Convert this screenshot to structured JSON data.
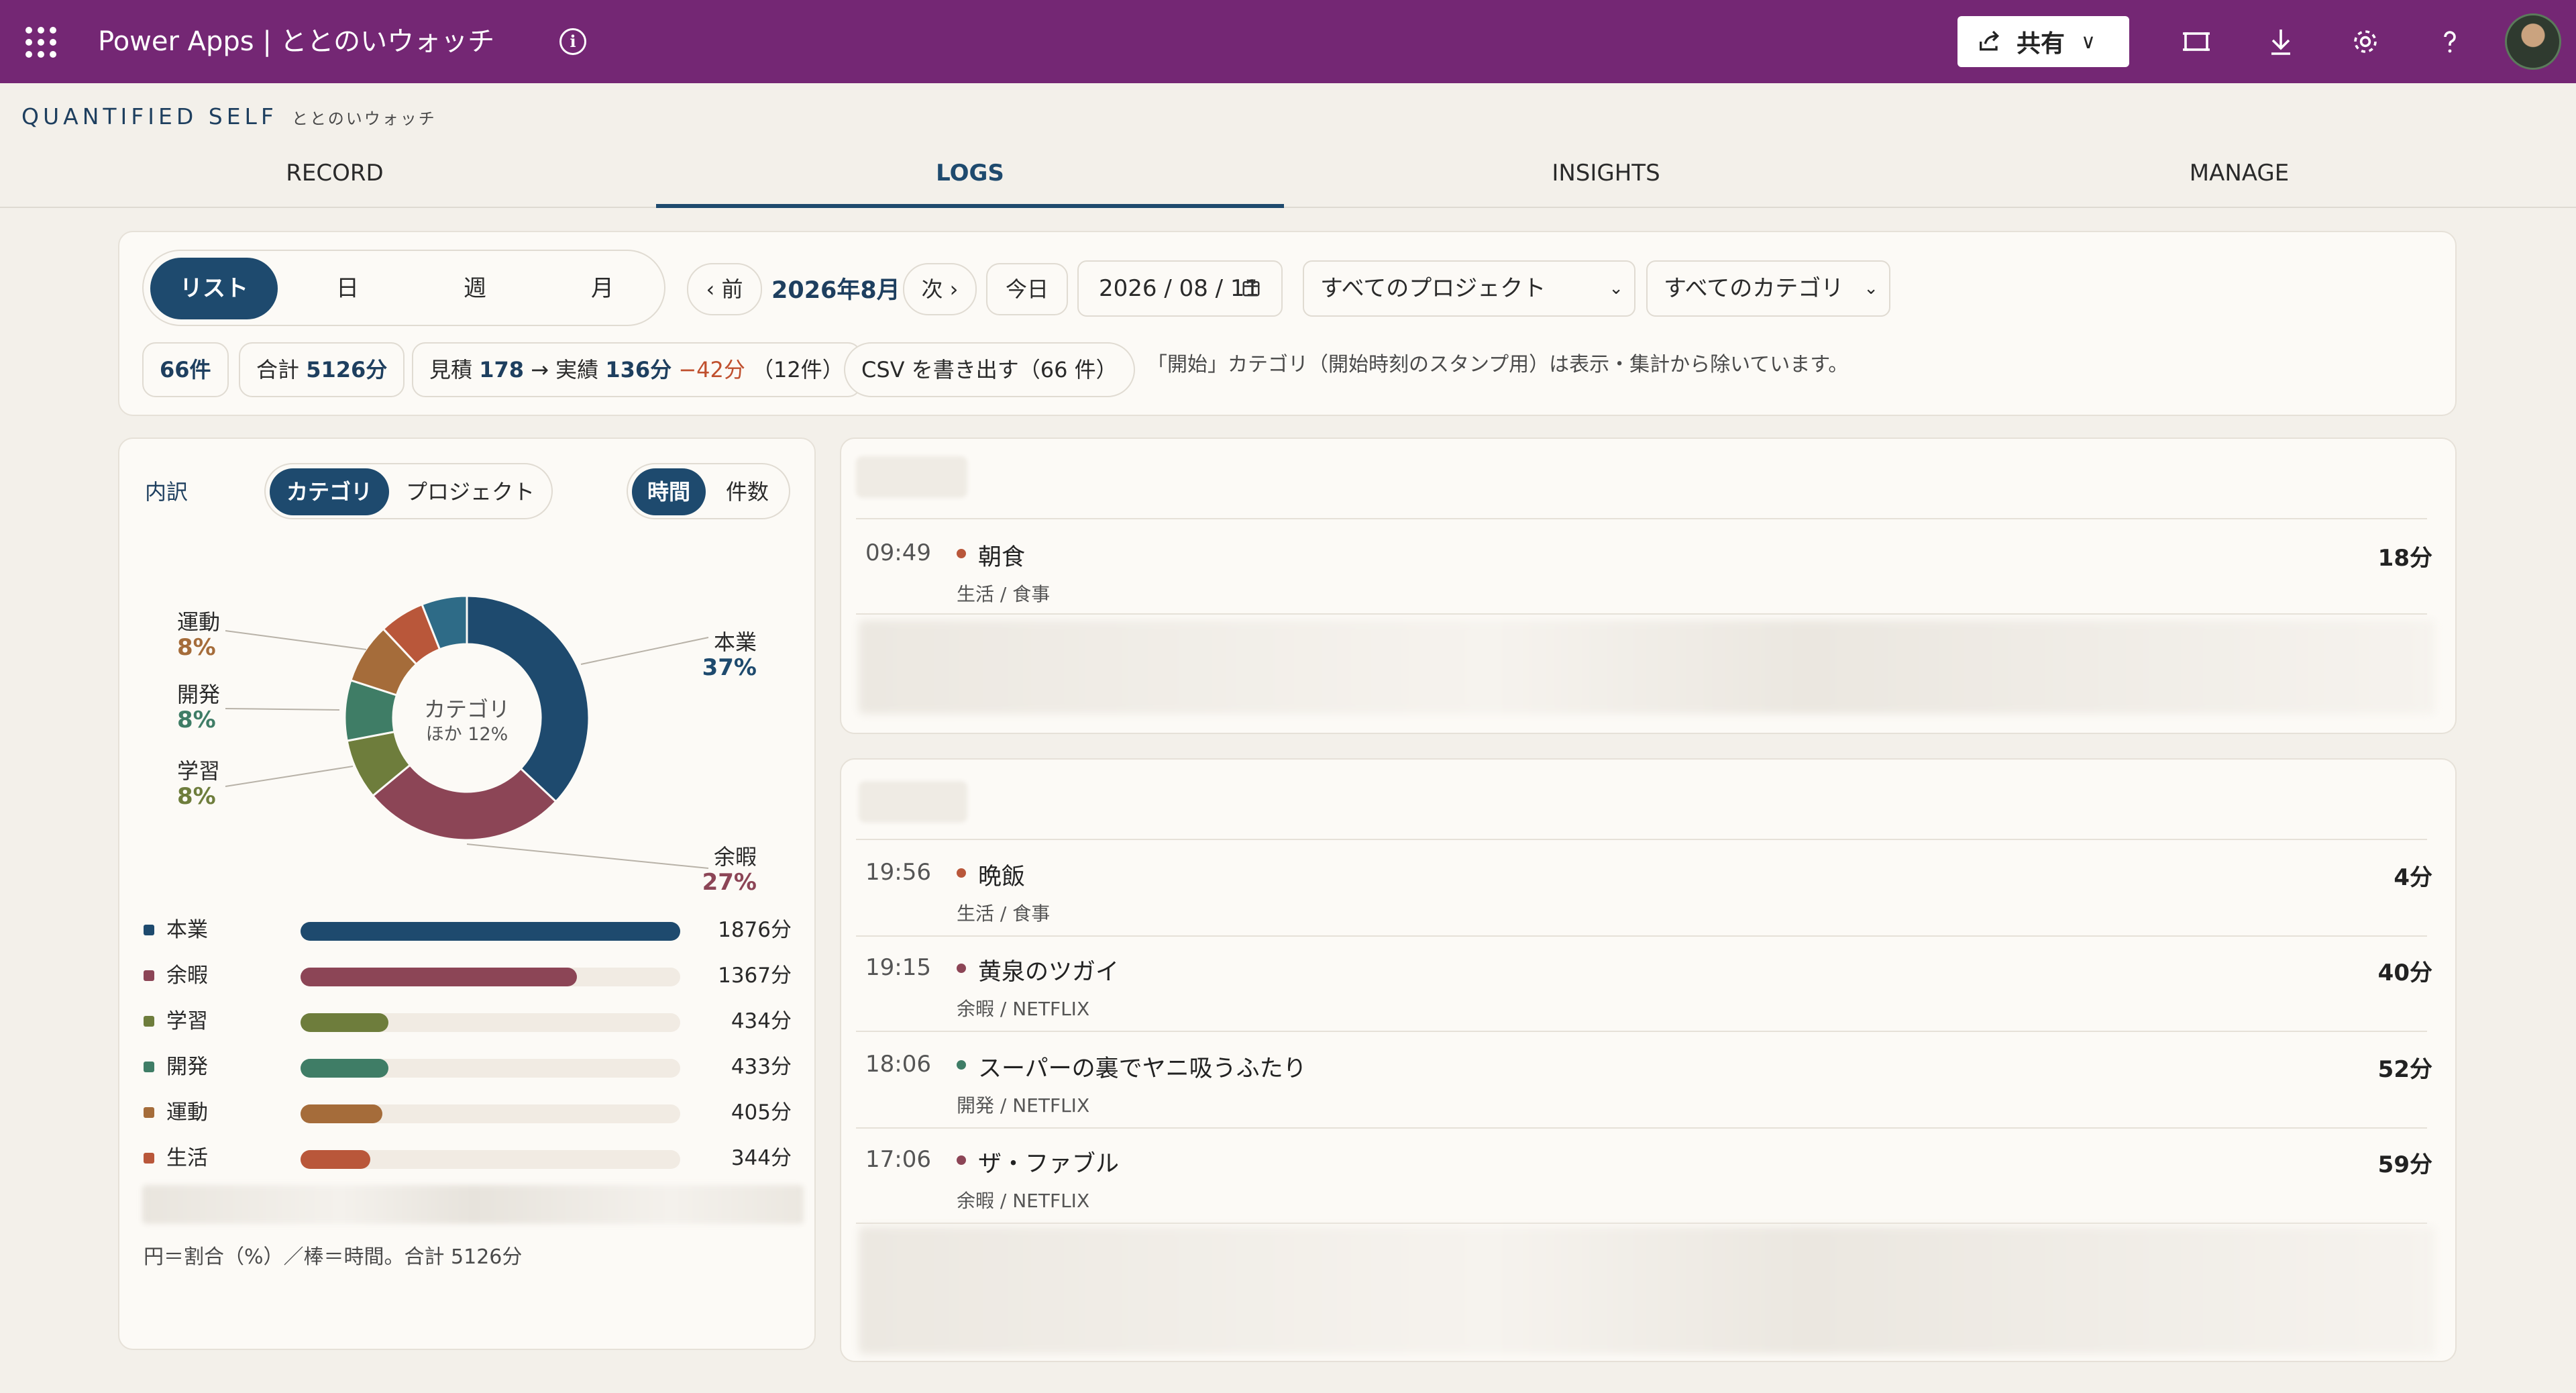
{
  "topbar": {
    "app_title": "Power Apps | ととのいウォッチ",
    "share_label": "共有",
    "icons": [
      "waffle-icon",
      "info-icon",
      "share-icon",
      "fit-screen-icon",
      "download-icon",
      "settings-icon",
      "help-icon",
      "avatar"
    ]
  },
  "header": {
    "brand": "QUANTIFIED SELF",
    "brand_sub": "ととのいウォッチ"
  },
  "tabs": [
    "RECORD",
    "LOGS",
    "INSIGHTS",
    "MANAGE"
  ],
  "active_tab": "LOGS",
  "filters": {
    "view_modes": [
      "リスト",
      "日",
      "週",
      "月"
    ],
    "active_view": "リスト",
    "prev_label": "‹ 前",
    "month_label": "2026年8月",
    "next_label": "次 ›",
    "today_label": "今日",
    "date_value": "2026 / 08 / 11",
    "project_select": "すべてのプロジェクト",
    "category_select": "すべてのカテゴリ",
    "count_value": "66件",
    "total_prefix": "合計",
    "total_value": "5126分",
    "estimate_prefix": "見積",
    "estimate_value": "178",
    "actual_prefix": "→ 実績",
    "actual_value": "136分",
    "diff_value": "−42分",
    "diff_count": "（12件）",
    "csv_label": "CSV を書き出す（66 件）",
    "note": "「開始」カテゴリ（開始時刻のスタンプ用）は表示・集計から除いています。"
  },
  "breakdown": {
    "title": "内訳",
    "group_modes": [
      "カテゴリ",
      "プロジェクト"
    ],
    "active_group": "カテゴリ",
    "metric_modes": [
      "時間",
      "件数"
    ],
    "active_metric": "時間",
    "donut_center_title": "カテゴリ",
    "donut_center_sub": "ほか 12%",
    "footnote": "円＝割合（%）／棒＝時間。合計 5126分"
  },
  "chart_data": {
    "type": "pie",
    "title": "",
    "total_minutes": 5126,
    "donut_labels": [
      {
        "name": "本業",
        "pct_label": "37%"
      },
      {
        "name": "余暇",
        "pct_label": "27%"
      },
      {
        "name": "学習",
        "pct_label": "8%"
      },
      {
        "name": "開発",
        "pct_label": "8%"
      },
      {
        "name": "運動",
        "pct_label": "8%"
      }
    ],
    "categories": [
      "本業",
      "余暇",
      "学習",
      "開発",
      "運動",
      "生活"
    ],
    "values": [
      1876,
      1367,
      434,
      433,
      405,
      344
    ],
    "value_labels": [
      "1876分",
      "1367分",
      "434分",
      "433分",
      "405分",
      "344分"
    ],
    "colors": [
      "#1e4a6e",
      "#8c4556",
      "#6e7d3c",
      "#3f7d66",
      "#a56c3a",
      "#b9573a"
    ],
    "bar_max": 1876,
    "other_slice_color": "#2e6b87"
  },
  "log_groups": [
    {
      "entries": [
        {
          "time": "09:49",
          "title": "朝食",
          "meta": "生活 / 食事",
          "duration": "18分",
          "color": "#b9573a"
        }
      ]
    },
    {
      "entries": [
        {
          "time": "19:56",
          "title": "晩飯",
          "meta": "生活 / 食事",
          "duration": "4分",
          "color": "#b9573a"
        },
        {
          "time": "19:15",
          "title": "黄泉のツガイ",
          "meta": "余暇 / NETFLIX",
          "duration": "40分",
          "color": "#8c4556"
        },
        {
          "time": "18:06",
          "title": "スーパーの裏でヤニ吸うふたり",
          "meta": "開発 / NETFLIX",
          "duration": "52分",
          "color": "#3f7d66"
        },
        {
          "time": "17:06",
          "title": "ザ・ファブル",
          "meta": "余暇 / NETFLIX",
          "duration": "59分",
          "color": "#8c4556"
        }
      ]
    }
  ]
}
